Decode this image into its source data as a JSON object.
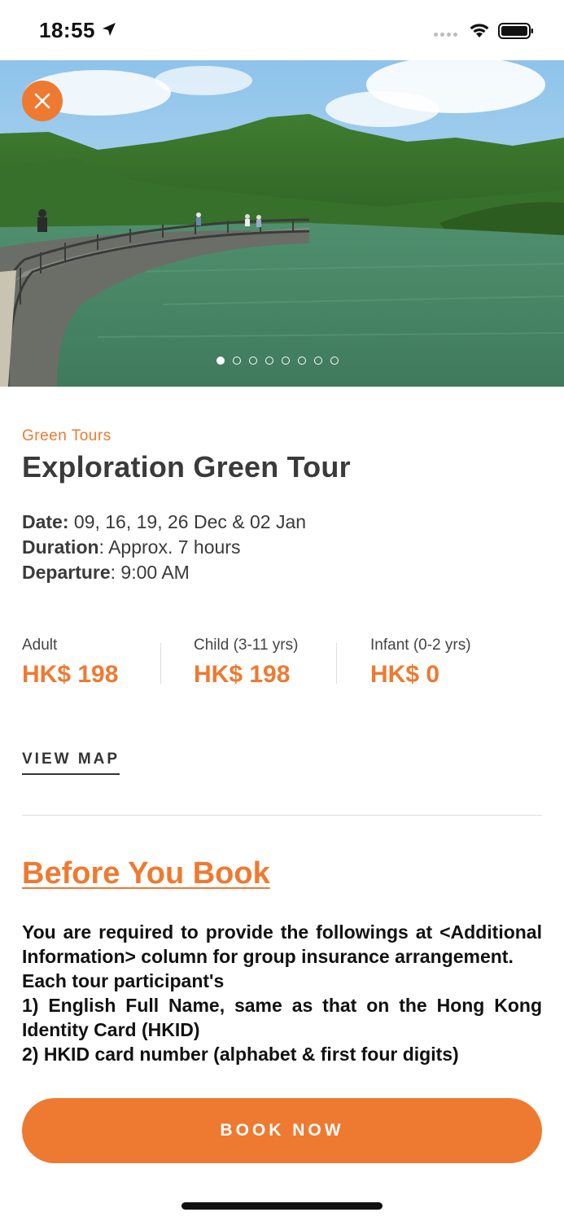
{
  "status_bar": {
    "time": "18:55",
    "icons": [
      "location-arrow-icon",
      "signal-icon",
      "wifi-icon",
      "battery-icon"
    ]
  },
  "hero": {
    "image_description_icon": "reservoir-landscape-image",
    "close_icon": "close-icon",
    "carousel": {
      "total": 8,
      "active_index": 0
    }
  },
  "tour": {
    "category": "Green Tours",
    "title": "Exploration Green Tour",
    "date_label": "Date:",
    "date_value": " 09, 16, 19, 26 Dec & 02 Jan",
    "duration_label": "Duration",
    "duration_value": ": Approx. 7 hours",
    "departure_label": "Departure",
    "departure_value": ": 9:00 AM"
  },
  "prices": [
    {
      "label": "Adult",
      "value": "HK$ 198"
    },
    {
      "label": "Child (3-11 yrs)",
      "value": "HK$ 198"
    },
    {
      "label": "Infant (0-2 yrs)",
      "value": "HK$ 0"
    }
  ],
  "links": {
    "view_map": "VIEW MAP"
  },
  "before_you_book": {
    "title": "Before You Book",
    "paragraph": "You are required to provide the followings at <Additional Information> column for group insurance arrangement.",
    "line1": "Each tour participant's",
    "line2": "1) English Full Name, same as that on the Hong Kong Identity Card (HKID)",
    "line3": "2) HKID card number (alphabet & first four digits)"
  },
  "actions": {
    "book_now": "BOOK NOW"
  },
  "colors": {
    "accent": "#ee7a31",
    "text": "#333333"
  }
}
